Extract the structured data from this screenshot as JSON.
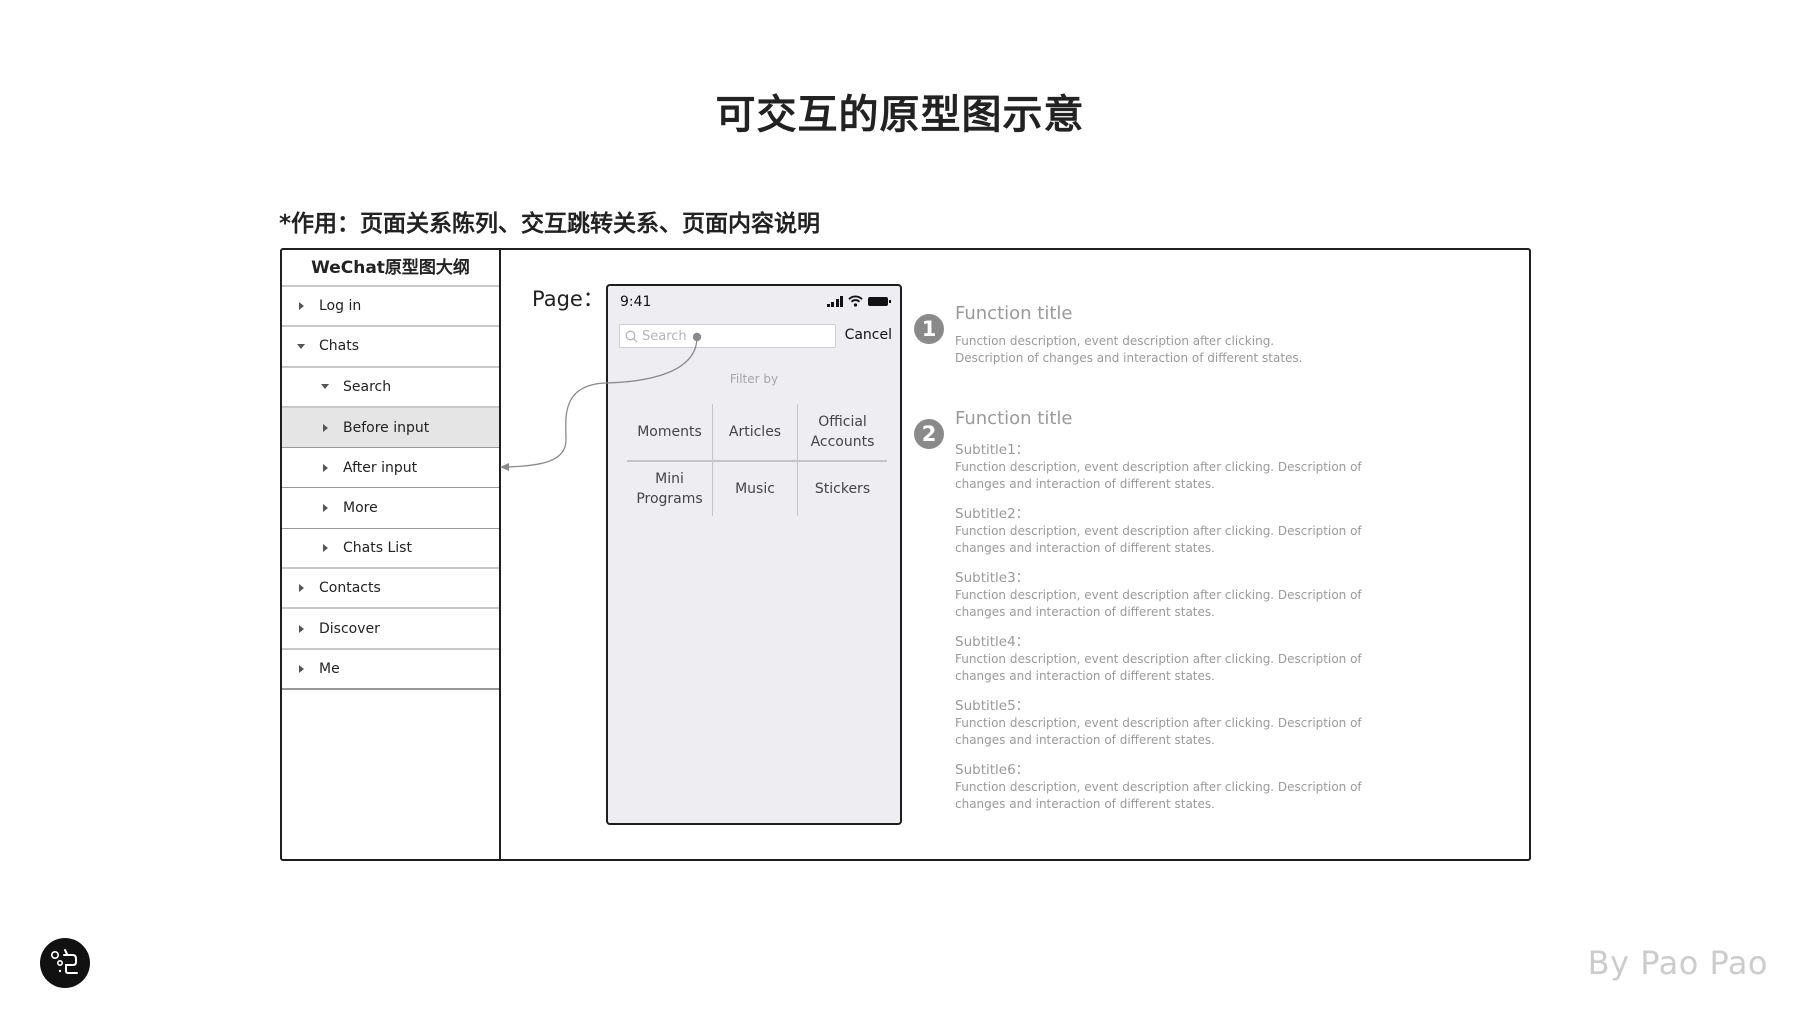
{
  "title": "可交互的原型图示意",
  "purpose": "*作用：页面关系陈列、交互跳转关系、页面内容说明",
  "outline": {
    "header": "WeChat原型图大纲",
    "items": [
      {
        "label": "Log in",
        "level": 1,
        "expanded": false,
        "selected": false
      },
      {
        "label": "Chats",
        "level": 1,
        "expanded": true,
        "selected": false
      },
      {
        "label": "Search",
        "level": 2,
        "expanded": true,
        "selected": false
      },
      {
        "label": "Before input",
        "level": 2,
        "expanded": false,
        "selected": true
      },
      {
        "label": "After input",
        "level": 2,
        "expanded": false,
        "selected": false
      },
      {
        "label": "More",
        "level": 2,
        "expanded": false,
        "selected": false
      },
      {
        "label": "Chats List",
        "level": 2,
        "expanded": false,
        "selected": false
      },
      {
        "label": "Contacts",
        "level": 1,
        "expanded": false,
        "selected": false
      },
      {
        "label": "Discover",
        "level": 1,
        "expanded": false,
        "selected": false
      },
      {
        "label": "Me",
        "level": 1,
        "expanded": false,
        "selected": false
      }
    ]
  },
  "page_label": "Page：",
  "phone": {
    "time": "9:41",
    "status_icons": [
      "signal-icon",
      "wifi-icon",
      "battery-icon"
    ],
    "search_placeholder": "Search",
    "cancel_label": "Cancel",
    "filter_by": "Filter by",
    "filters": [
      [
        "Moments",
        "Articles",
        "Official Accounts"
      ],
      [
        "Mini Programs",
        "Music",
        "Stickers"
      ]
    ]
  },
  "connector": {
    "from": "search-input",
    "to": "outline-item-after-input"
  },
  "annotations": [
    {
      "number": "1",
      "title": "Function title",
      "description_lines": [
        "Function description, event description after clicking.",
        "Description of changes and interaction of different states."
      ]
    },
    {
      "number": "2",
      "title": "Function title",
      "subtitles": [
        {
          "label": "Subtitle1：",
          "lines": [
            "Function description, event description after clicking. Description of",
            "changes and interaction of different states."
          ]
        },
        {
          "label": "Subtitle2：",
          "lines": [
            "Function description, event description after clicking. Description of",
            "changes and interaction of different states."
          ]
        },
        {
          "label": "Subtitle3：",
          "lines": [
            "Function description, event description after clicking. Description of",
            "changes and interaction of different states."
          ]
        },
        {
          "label": "Subtitle4：",
          "lines": [
            "Function description, event description after clicking. Description of",
            "changes and interaction of different states."
          ]
        },
        {
          "label": "Subtitle5：",
          "lines": [
            "Function description, event description after clicking. Description of",
            "changes and interaction of different states."
          ]
        },
        {
          "label": "Subtitle6：",
          "lines": [
            "Function description, event description after clicking. Description of",
            "changes and interaction of different states."
          ]
        }
      ]
    }
  ],
  "footer": {
    "logo": "pao-logo-icon",
    "byline": "By Pao Pao"
  },
  "colors": {
    "frame": "#1e1e1e",
    "selected_row": "#e5e5e5",
    "phone_bg": "#eeedf2",
    "annotation_gray": "#8a8a8a",
    "byline": "#cccccc"
  }
}
